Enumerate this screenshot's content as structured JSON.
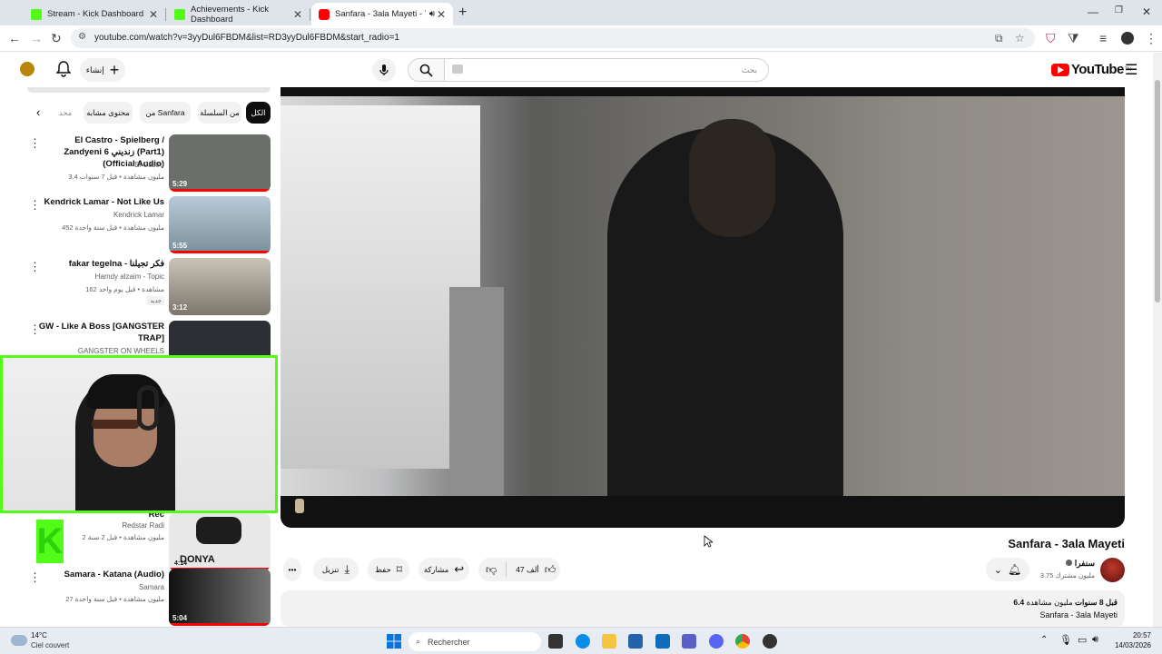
{
  "browser": {
    "tabs": [
      {
        "title": "Stream - Kick Dashboard",
        "favicon_color": "#53fc18"
      },
      {
        "title": "Achievements - Kick Dashboard",
        "favicon_color": "#53fc18"
      },
      {
        "title": "Sanfara - 3ala Mayeti - You",
        "favicon_color": "#ff0000"
      }
    ],
    "url": "youtube.com/watch?v=3yyDul6FBDM&list=RD3yyDul6FBDM&start_radio=1"
  },
  "youtube_header": {
    "create_label": "إنشاء",
    "search_placeholder": "بحث",
    "logo_text": "YouTube",
    "logo_region": "TN"
  },
  "chips": [
    {
      "label": "الكل",
      "active": true
    },
    {
      "label": "من السلسلة",
      "active": false
    },
    {
      "label": "من Sanfara",
      "active": false
    },
    {
      "label": "محتوى مشابه",
      "active": false
    },
    {
      "label": "محد",
      "active": false
    }
  ],
  "sidebar_videos": [
    {
      "title": "El Castro - Spielberg / Zandyeni زنديني 6 (Part1) (Official Audio)",
      "channel": "El Castro",
      "meta": "3.4 مليون مشاهدة • قبل 7 سنوات",
      "duration": "5:29",
      "thumb_color": "#6a6f6a"
    },
    {
      "title": "Kendrick Lamar - Not Like Us",
      "channel": "Kendrick Lamar",
      "meta": "452 مليون مشاهدة • قبل سنة واحدة",
      "duration": "5:55",
      "thumb_color": "#9fb4c4"
    },
    {
      "title": "fakar tegelna - فكر تجيلنا",
      "channel": "Hamdy alzaim - Topic",
      "meta": "162 مشاهدة • قبل يوم واحد",
      "badge": "جديد",
      "duration": "3:12",
      "thumb_color": "#8a857e"
    },
    {
      "title": "GW - Like A Boss [GANGSTER TRAP]",
      "channel": "GANGSTER ON WHEELS",
      "meta": "",
      "duration": "",
      "thumb_color": "#2c2f33"
    },
    {
      "title": "Rec",
      "channel": "Redstar Radi",
      "meta": "2 مليون مشاهدة • قبل 2 سنة",
      "duration": "4:14",
      "thumb_color": "#d9d9d9",
      "thumb_text": "DONYA"
    },
    {
      "title": "Samara - Katana (Audio)",
      "channel": "Samara",
      "meta": "27 مليون مشاهدة • قبل سنة واحدة",
      "duration": "5:04",
      "thumb_color": "#3a3a3a"
    }
  ],
  "video": {
    "title": "Sanfara - 3ala Mayeti",
    "channel_name": "سنفرا",
    "subscribers": "3.75 مليون مشترك",
    "likes": "47 ألف",
    "share_label": "مشاركة",
    "save_label": "حفظ",
    "download_label": "تنزيل",
    "views": "6.4",
    "views_unit": "مليون مشاهدة",
    "age": "قبل 8 سنوات",
    "description_title": "Sanfara - 3ala Mayeti"
  },
  "taskbar": {
    "weather_temp": "14°C",
    "weather_desc": "Ciel couvert",
    "search_placeholder": "Rechercher",
    "time": "20:57",
    "date": "14/03/2026"
  },
  "icons": {
    "accent": "#53fc18",
    "youtube_red": "#ff0000"
  }
}
